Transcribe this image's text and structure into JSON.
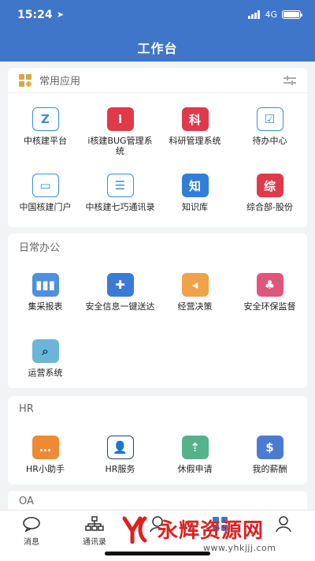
{
  "status_bar": {
    "time": "15:24",
    "location_glyph": "➤",
    "network": "4G"
  },
  "header": {
    "title": "工作台"
  },
  "common_apps": {
    "title": "常用应用",
    "items": [
      {
        "label": "中核建平台",
        "icon": "zhongheijian-platform-icon",
        "glyph": "Z",
        "color": "#ffffff",
        "fg": "#3a8fd9"
      },
      {
        "label": "i核建BUG管理系统",
        "icon": "bug-system-icon",
        "glyph": "I",
        "color": "#e0394a",
        "fg": "#ffffff"
      },
      {
        "label": "科研管理系统",
        "icon": "research-icon",
        "glyph": "科",
        "color": "#e0394a",
        "fg": "#ffffff"
      },
      {
        "label": "待办中心",
        "icon": "todo-icon",
        "glyph": "☑",
        "color": "#ffffff",
        "fg": "#3a8fd9"
      },
      {
        "label": "中国核建门户",
        "icon": "portal-icon",
        "glyph": "▭",
        "color": "#ffffff",
        "fg": "#3a8fd9"
      },
      {
        "label": "中核建七巧通讯录",
        "icon": "contacts-book-icon",
        "glyph": "☰",
        "color": "#ffffff",
        "fg": "#3a8fd9"
      },
      {
        "label": "知识库",
        "icon": "knowledge-icon",
        "glyph": "知",
        "color": "#2f7fd8",
        "fg": "#ffffff"
      },
      {
        "label": "综合部-股份",
        "icon": "general-dept-icon",
        "glyph": "综",
        "color": "#e0394a",
        "fg": "#ffffff"
      }
    ]
  },
  "daily_office": {
    "title": "日常办公",
    "items": [
      {
        "label": "集采报表",
        "icon": "bar-chart-icon",
        "glyph": "▮▮▮",
        "color": "#4e8fe0",
        "fg": "#ffffff"
      },
      {
        "label": "安全信息一键送达",
        "icon": "safety-monitor-icon",
        "glyph": "✚",
        "color": "#3a7bd5",
        "fg": "#ffffff"
      },
      {
        "label": "经营决策",
        "icon": "decision-icon",
        "glyph": "◂",
        "color": "#f0a24a",
        "fg": "#ffffff"
      },
      {
        "label": "安全环保监督",
        "icon": "environment-icon",
        "glyph": "♣",
        "color": "#e0557a",
        "fg": "#ffffff"
      },
      {
        "label": "运营系统",
        "icon": "operations-icon",
        "glyph": "⌕",
        "color": "#6bb6d8",
        "fg": "#1e3a5a"
      }
    ]
  },
  "hr": {
    "title": "HR",
    "items": [
      {
        "label": "HR小助手",
        "icon": "chat-bubble-icon",
        "glyph": "…",
        "color": "#ee8a32",
        "fg": "#ffffff"
      },
      {
        "label": "HR服务",
        "icon": "person-icon",
        "glyph": "👤",
        "color": "#ffffff",
        "fg": "#2b3f6a"
      },
      {
        "label": "休假申请",
        "icon": "leave-icon",
        "glyph": "⇡",
        "color": "#54b38a",
        "fg": "#ffffff"
      },
      {
        "label": "我的薪酬",
        "icon": "money-bag-icon",
        "glyph": "$",
        "color": "#4a7bd0",
        "fg": "#ffffff"
      }
    ]
  },
  "oa": {
    "title": "OA"
  },
  "tabbar": {
    "items": [
      {
        "label": "消息",
        "icon": "message-icon"
      },
      {
        "label": "通讯录",
        "icon": "org-chart-icon"
      },
      {
        "label": "",
        "icon": "center-tab-icon"
      },
      {
        "label": "",
        "icon": "workbench-icon"
      },
      {
        "label": "",
        "icon": "profile-icon"
      }
    ]
  },
  "watermark": {
    "text": "永辉资源网",
    "url": "www.yhkjjj.com"
  }
}
